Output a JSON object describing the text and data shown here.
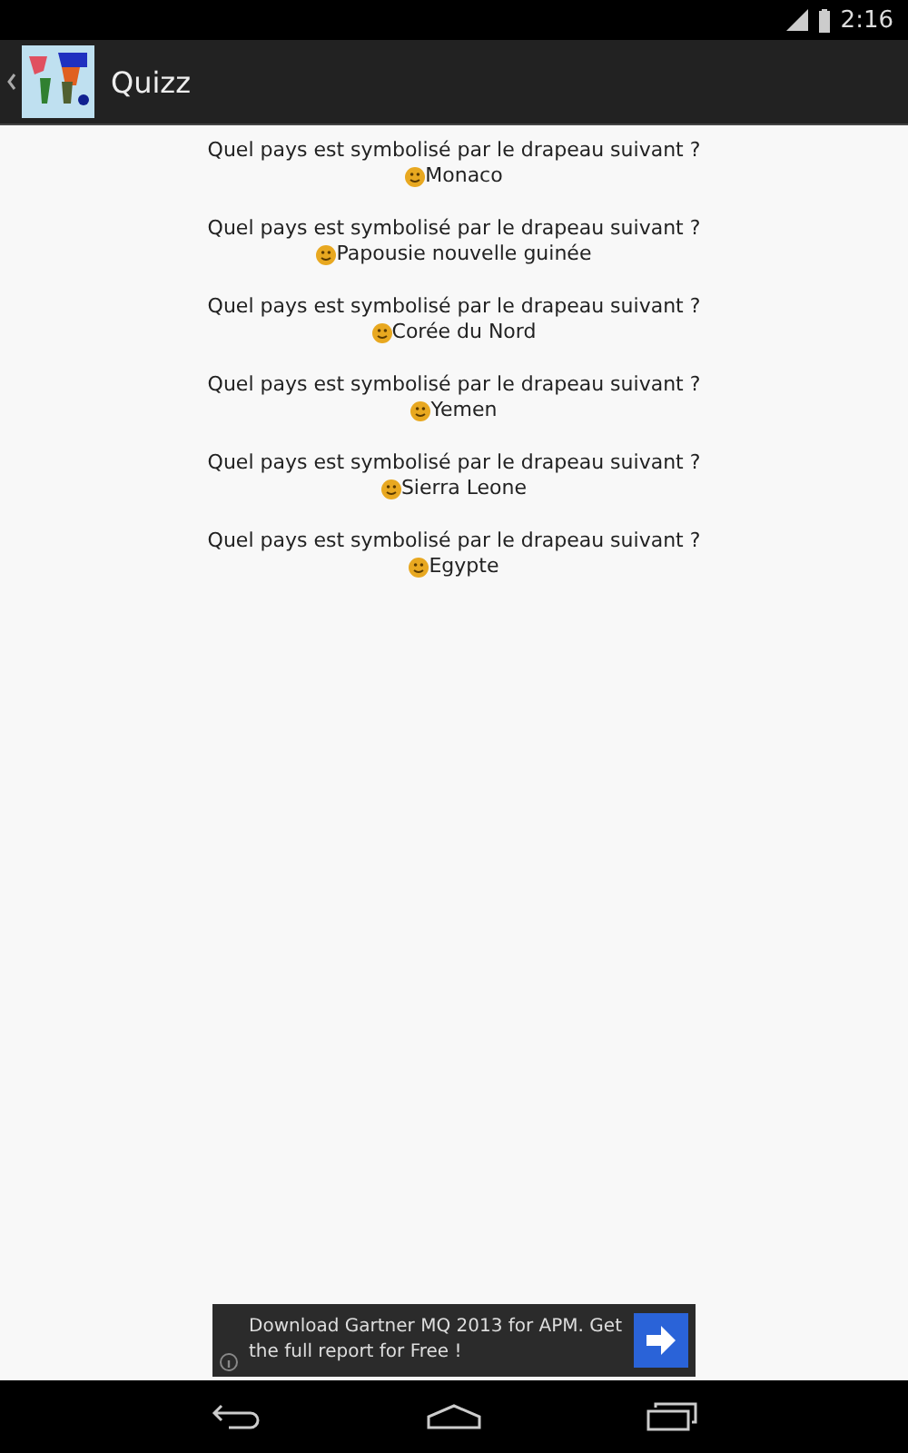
{
  "status_bar": {
    "time": "2:16"
  },
  "action_bar": {
    "title": "Quizz"
  },
  "questions": [
    {
      "question": "Quel pays est symbolisé par le drapeau suivant ?",
      "answer": "Monaco"
    },
    {
      "question": "Quel pays est symbolisé par le drapeau suivant ?",
      "answer": "Papousie nouvelle guinée"
    },
    {
      "question": "Quel pays est symbolisé par le drapeau suivant ?",
      "answer": "Corée du Nord"
    },
    {
      "question": "Quel pays est symbolisé par le drapeau suivant ?",
      "answer": "Yemen"
    },
    {
      "question": "Quel pays est symbolisé par le drapeau suivant ?",
      "answer": "Sierra Leone"
    },
    {
      "question": "Quel pays est symbolisé par le drapeau suivant ?",
      "answer": "Egypte"
    }
  ],
  "ad": {
    "text": "Download Gartner MQ 2013 for APM. Get the full report for Free !"
  }
}
